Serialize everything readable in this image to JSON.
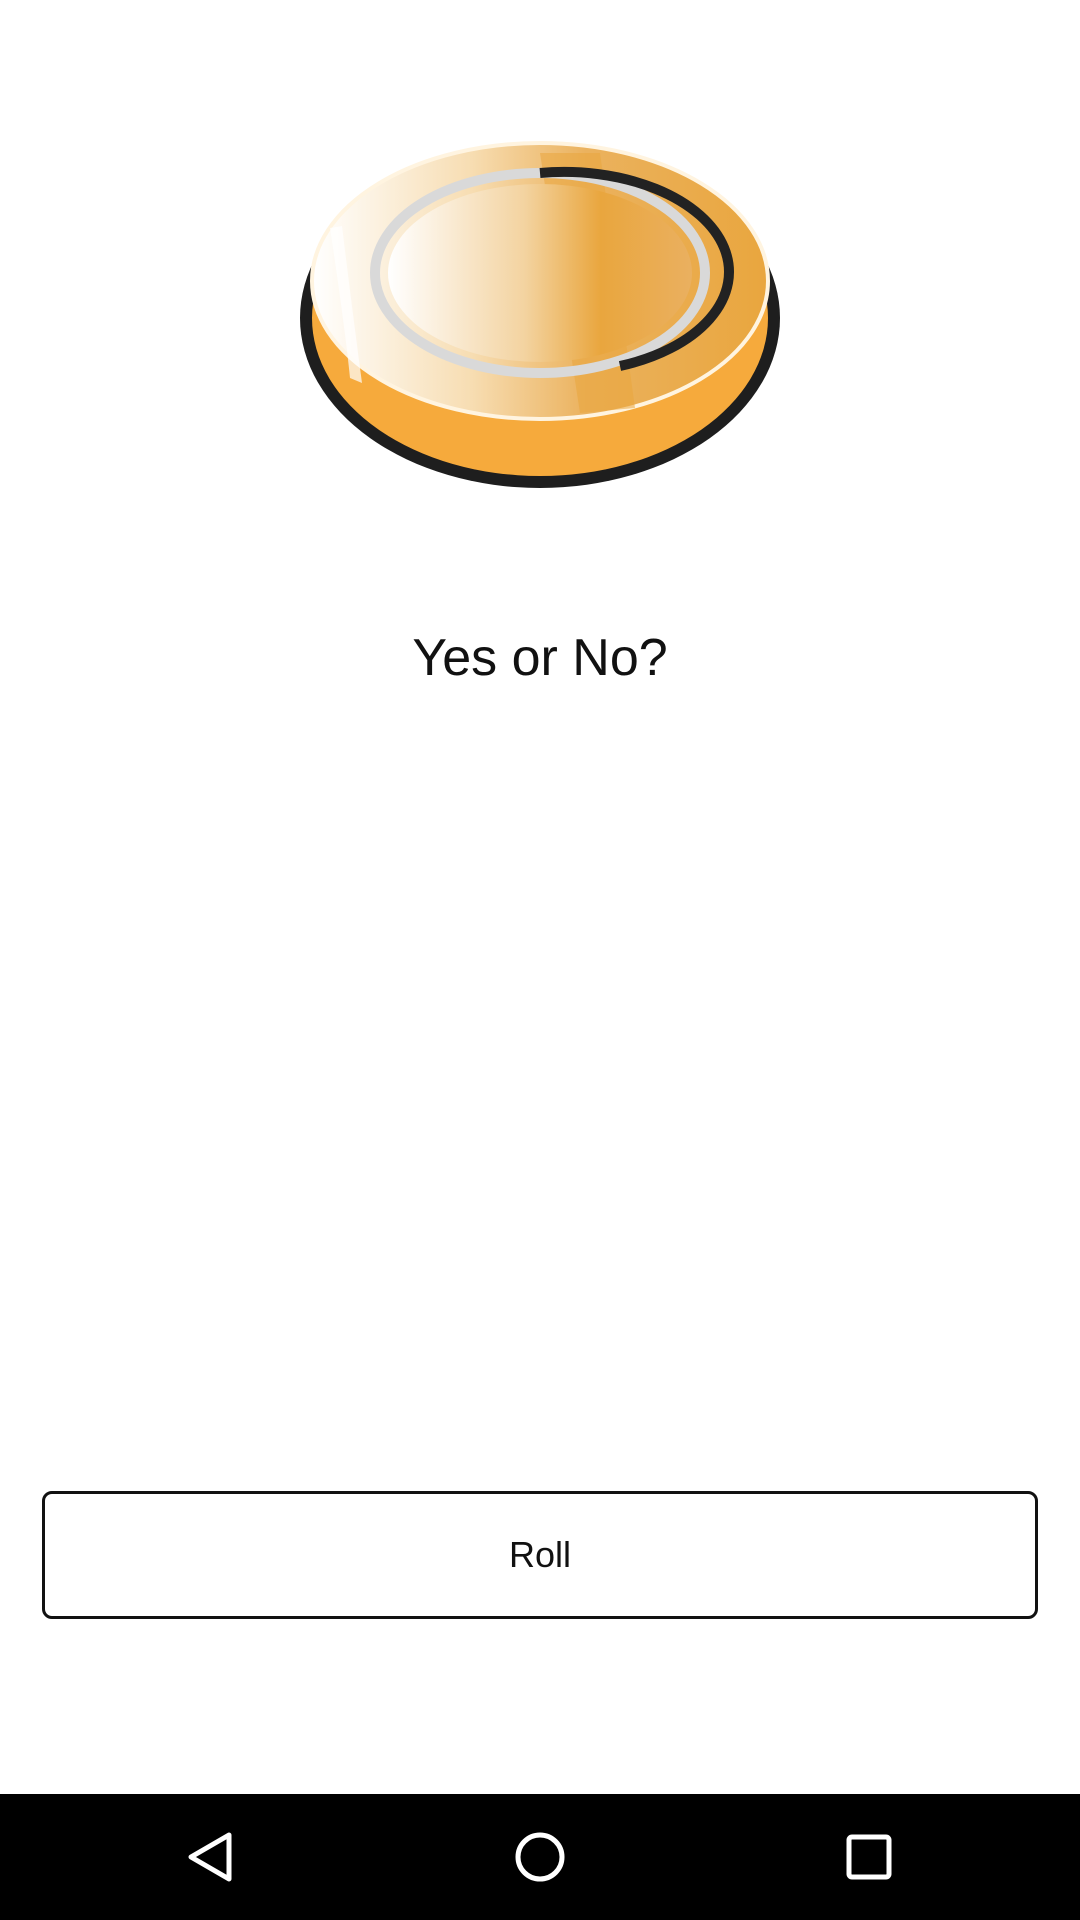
{
  "main": {
    "question_text": "Yes or No?",
    "roll_label": "Roll"
  },
  "coin": {
    "icon": "coin-icon",
    "colors": {
      "rim": "#F5A93A",
      "face": "#EBA53C",
      "outline": "#1A1A1A"
    }
  },
  "navbar": {
    "background": "#000000",
    "buttons": [
      {
        "icon": "back-icon"
      },
      {
        "icon": "home-icon"
      },
      {
        "icon": "recents-icon"
      }
    ]
  }
}
